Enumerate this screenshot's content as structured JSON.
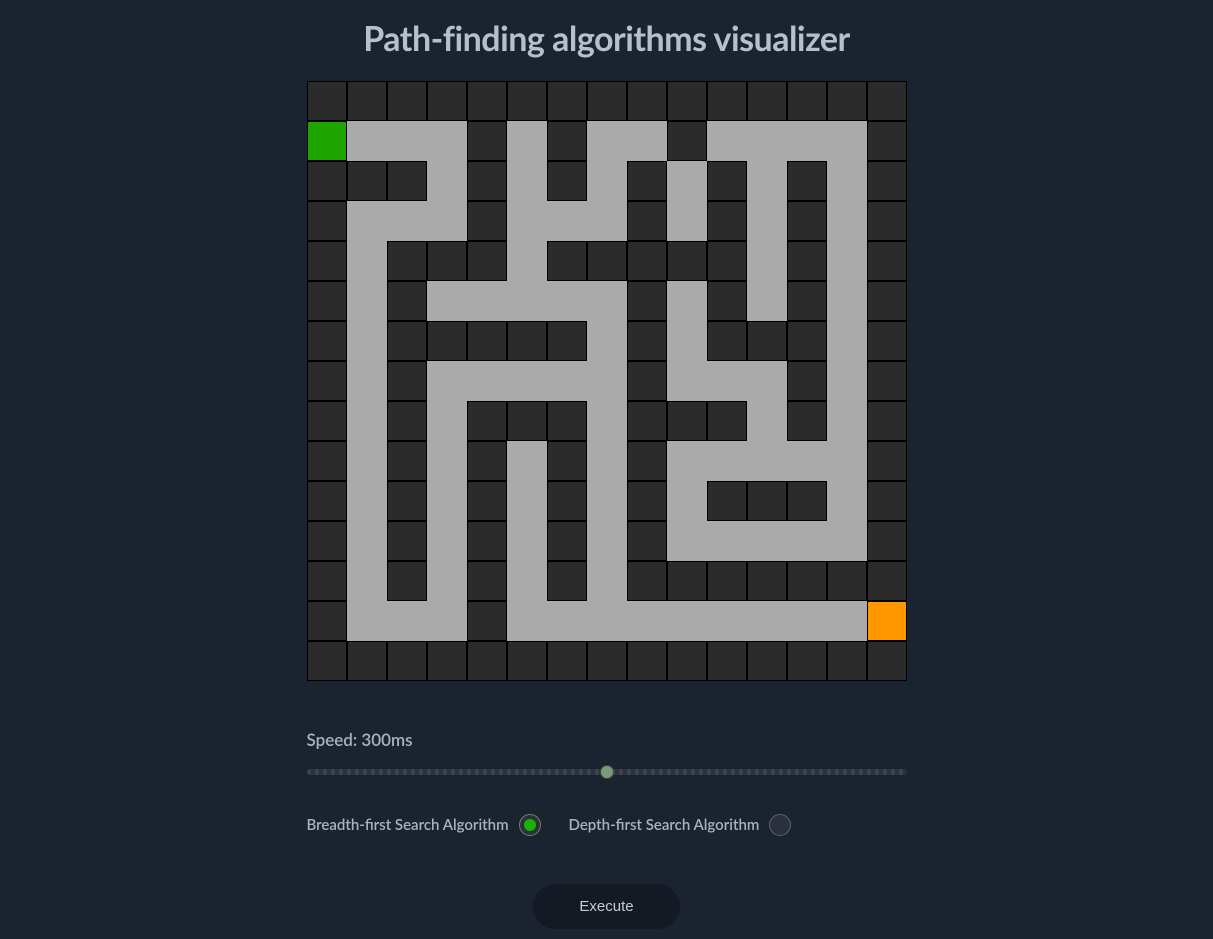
{
  "title": "Path-finding algorithms visualizer",
  "grid": {
    "cols": 15,
    "rows": 15,
    "start": [
      1,
      0
    ],
    "end": [
      13,
      14
    ],
    "cells": [
      "WWWWWWWWWWWWWWW",
      "S...W.W..W...PW",
      "WWW.W.W.W.W.WPW",
      "W...W...W.W.WPW",
      "W.WWW.WWWWW.WPW",
      "W.W.....W.W.WPW",
      "W.WWWWW.W.WWWPW",
      "W.W.....W...WPW",
      "W.W.WWW.WWW.WPW",
      "W.W.W.W.W..P.PW",
      "W.W.W.W.W.WWWPW",
      "W.W.W.W.W.....W",
      "W.W.W.W.WWWWWWW",
      "W.P.WP........E",
      "WWWWWWWWWWWWWWW"
    ]
  },
  "controls": {
    "speed_label_prefix": "Speed: ",
    "speed_value": "300ms",
    "slider_percent": 50,
    "algorithms": [
      {
        "id": "bfs",
        "label": "Breadth-first Search Algorithm",
        "selected": true
      },
      {
        "id": "dfs",
        "label": "Depth-first Search Algorithm",
        "selected": false
      }
    ],
    "execute_label": "Execute"
  }
}
